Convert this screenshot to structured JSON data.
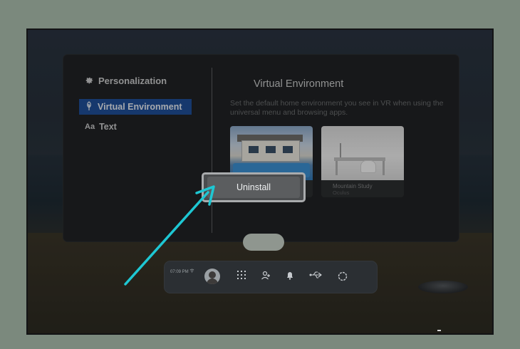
{
  "sidebar": {
    "title": "Personalization",
    "items": [
      {
        "label": "Virtual Environment",
        "icon": "tree-icon",
        "active": true
      },
      {
        "label": "Text",
        "icon": "text-size-icon",
        "active": false
      }
    ]
  },
  "main": {
    "title": "Virtual Environment",
    "description": "Set the default home environment you see in VR when using the universal menu and browsing apps.",
    "environments": [
      {
        "name": "",
        "publisher": ""
      },
      {
        "name": "Mountain Study",
        "publisher": "Oculus"
      }
    ]
  },
  "context_menu": {
    "uninstall_label": "Uninstall"
  },
  "dock": {
    "time": "07:09 PM",
    "icons": [
      "wifi-icon",
      "avatar",
      "apps-grid-icon",
      "people-icon",
      "bell-icon",
      "usb-icon",
      "settings-icon"
    ]
  },
  "colors": {
    "accent": "#1f4e97",
    "arrow": "#1ec7d3",
    "background": "#7b897d"
  }
}
